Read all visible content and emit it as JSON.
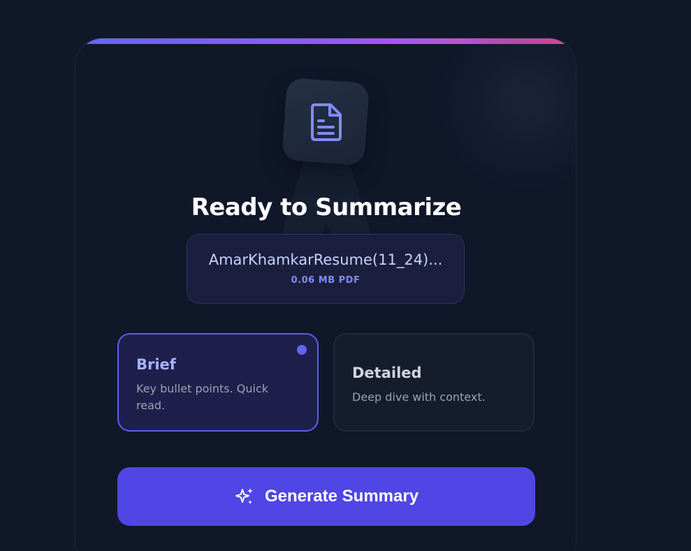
{
  "summarizer": {
    "title": "Ready to Summarize",
    "file": {
      "name": "AmarKhamkarResume(11_24)...",
      "meta": "0.06 MB PDF",
      "icon": "file-text-icon"
    },
    "options": [
      {
        "label": "Brief",
        "description": "Key bullet points. Quick read.",
        "selected": true
      },
      {
        "label": "Detailed",
        "description": "Deep dive with context.",
        "selected": false
      }
    ],
    "generate_button": {
      "label": "Generate Summary",
      "icon": "sparkles-icon"
    }
  },
  "colors": {
    "background": "#111827",
    "card": "#0f1729",
    "accent": "#4f46e5",
    "accent_light": "#818cf8",
    "gradient": [
      "#6366f1",
      "#a855f7",
      "#ec4899"
    ]
  }
}
